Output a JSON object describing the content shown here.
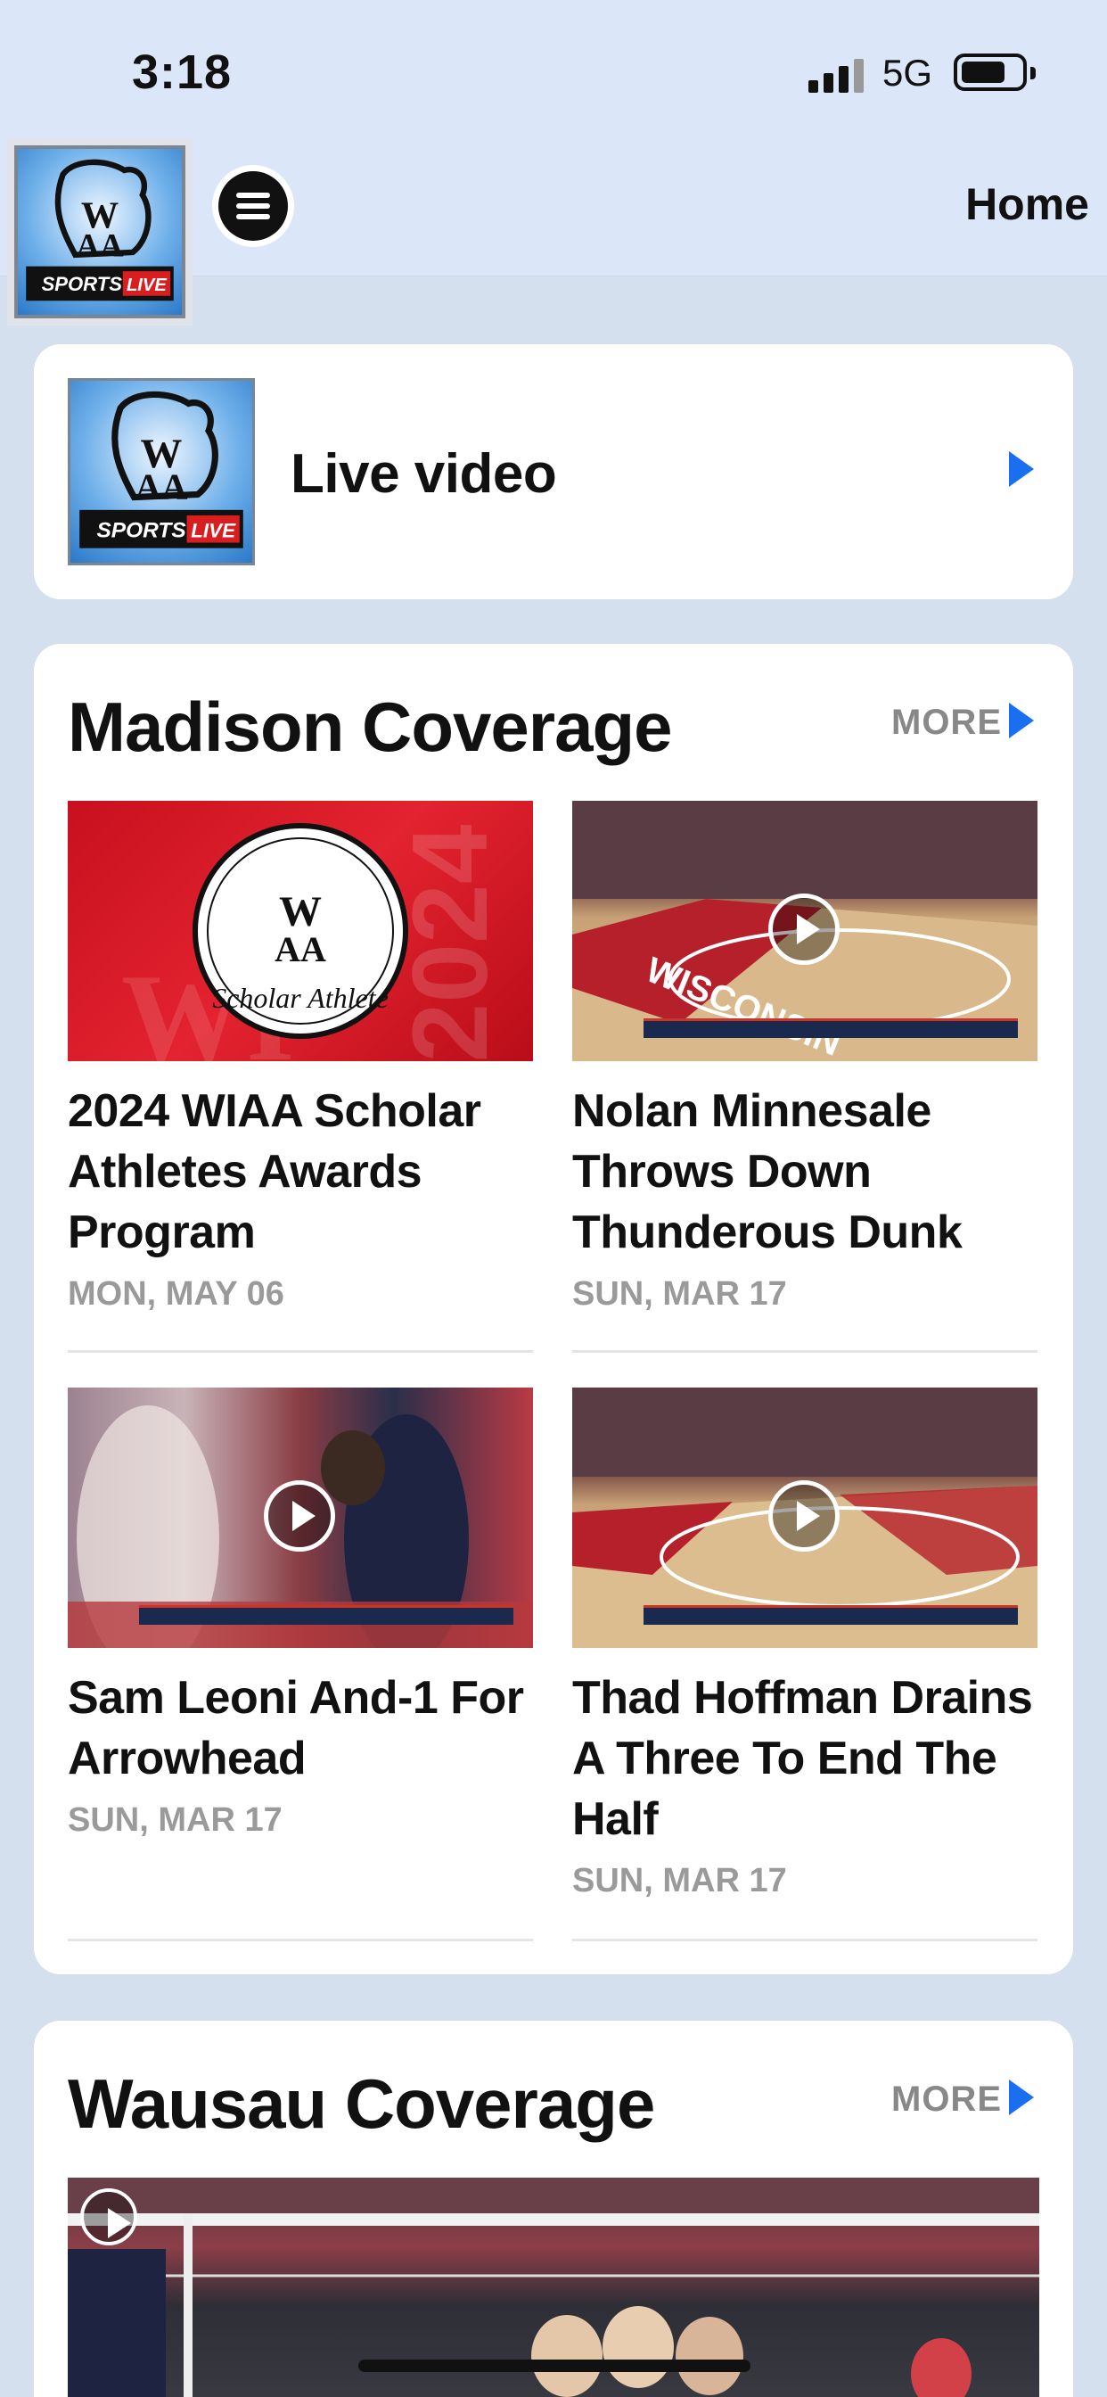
{
  "status": {
    "time": "3:18",
    "network": "5G"
  },
  "header": {
    "logo": "WIAA Sports Live",
    "home_label": "Home"
  },
  "live": {
    "title": "Live video"
  },
  "sections": [
    {
      "title": "Madison Coverage",
      "more_label": "MORE",
      "items": [
        {
          "title": "2024 WIAA Scholar Athletes Awards Program",
          "date": "MON, MAY 06",
          "thumb_icon": "scholar-athlete-logo"
        },
        {
          "title": "Nolan Minnesale Throws Down Thunderous Dunk",
          "date": "SUN, MAR 17",
          "thumb_icon": "play-icon"
        },
        {
          "title": "Sam Leoni And-1 For Arrowhead",
          "date": "SUN, MAR 17",
          "thumb_icon": "play-icon"
        },
        {
          "title": "Thad Hoffman Drains A Three To End The Half",
          "date": "SUN, MAR 17",
          "thumb_icon": "play-icon"
        }
      ]
    },
    {
      "title": "Wausau Coverage",
      "more_label": "MORE",
      "items": []
    }
  ],
  "colors": {
    "accent": "#1a6ff0",
    "header_bg": "#dbe7f8",
    "page_bg": "#d5e0ee"
  }
}
